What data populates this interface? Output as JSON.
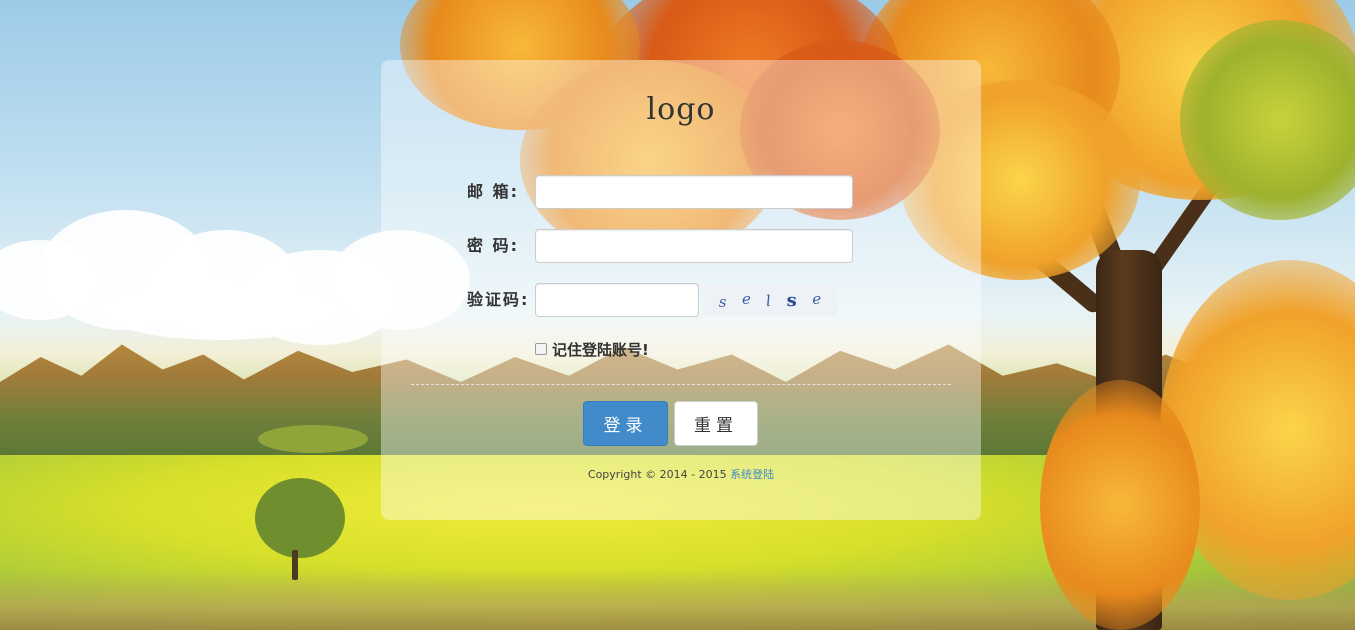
{
  "panel": {
    "logo_text": "logo"
  },
  "form": {
    "email_label": "邮 箱:",
    "email_value": "",
    "password_label": "密 码:",
    "password_value": "",
    "captcha_label": "验证码:",
    "captcha_value": "",
    "captcha_chars": [
      "s",
      "e",
      "l",
      "s",
      "e"
    ],
    "remember_label": "记住登陆账号!",
    "remember_checked": false
  },
  "buttons": {
    "login_label": "登录",
    "reset_label": "重置"
  },
  "footer": {
    "copyright_prefix": "Copyright © 2014 - 2015",
    "copyright_link": "系统登陆"
  },
  "colors": {
    "primary": "#428bca",
    "panel_overlay": "rgba(255,255,255,0.4)"
  }
}
